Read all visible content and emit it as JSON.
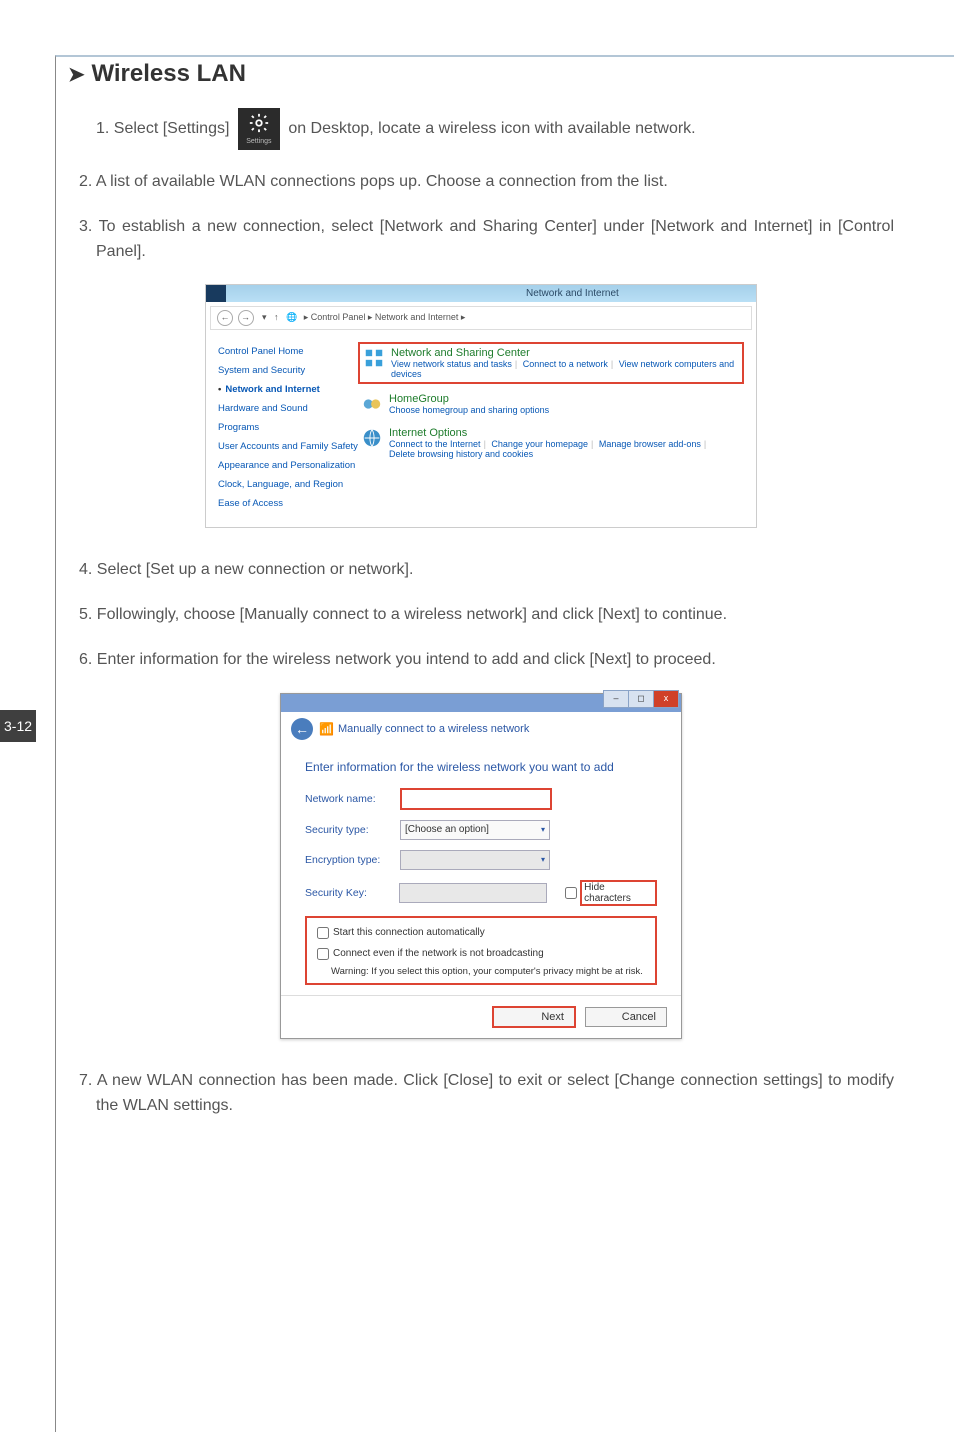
{
  "heading_prefix": "➤",
  "heading": "Wireless LAN",
  "page_number": "3-12",
  "steps": {
    "s1_a": "1. Select [Settings]",
    "s1_b": "on Desktop, locate a wireless icon with available network.",
    "s2": "2. A list of available WLAN connections pops up. Choose a connection from the list.",
    "s3": "3. To establish a new connection, select [Network and Sharing Center] under [Network and Internet] in [Control Panel].",
    "s4": "4. Select [Set up a new connection or network].",
    "s5": "5. Followingly, choose [Manually connect to a wireless network] and click [Next] to continue.",
    "s6": "6. Enter information for the wireless network you intend to add and click [Next] to proceed.",
    "s7": "7. A new WLAN connection has been made. Click [Close] to exit or select [Change connection settings] to modify the WLAN settings."
  },
  "settings_tile_label": "Settings",
  "control_panel": {
    "title": "Network and Internet",
    "breadcrumb": "▸ Control Panel ▸ Network and Internet ▸",
    "left": {
      "home": "Control Panel Home",
      "sys": "System and Security",
      "net": "Network and Internet",
      "hw": "Hardware and Sound",
      "prog": "Programs",
      "user": "User Accounts and Family Safety",
      "app": "Appearance and Personalization",
      "clock": "Clock, Language, and Region",
      "ease": "Ease of Access"
    },
    "cats": {
      "nsc": {
        "title": "Network and Sharing Center",
        "l1": "View network status and tasks",
        "l2": "Connect to a network",
        "l3": "View network computers and devices"
      },
      "hg": {
        "title": "HomeGroup",
        "l1": "Choose homegroup and sharing options"
      },
      "io": {
        "title": "Internet Options",
        "l1": "Connect to the Internet",
        "l2": "Change your homepage",
        "l3": "Manage browser add-ons",
        "l4": "Delete browsing history and cookies"
      }
    }
  },
  "manual_connect": {
    "header": "Manually connect to a wireless network",
    "subheader": "Enter information for the wireless network you want to add",
    "fields": {
      "name": "Network name:",
      "sec": "Security type:",
      "sec_value": "[Choose an option]",
      "enc": "Encryption type:",
      "key": "Security Key:",
      "hide": "Hide characters"
    },
    "opts": {
      "auto": "Start this connection automatically",
      "connect_even": "Connect even if the network is not broadcasting",
      "warn": "Warning: If you select this option, your computer's privacy might be at risk."
    },
    "next": "Next",
    "cancel": "Cancel",
    "close_x": "x"
  }
}
